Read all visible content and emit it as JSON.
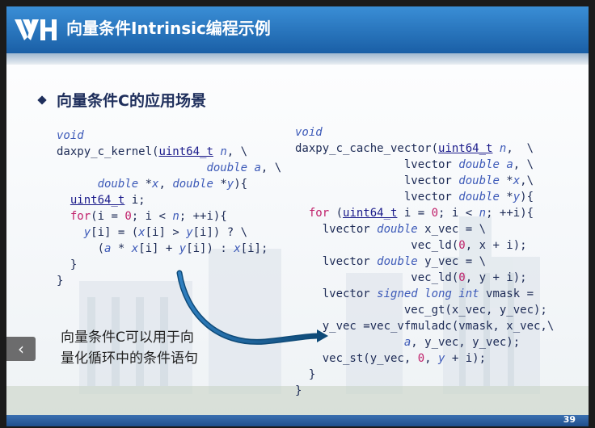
{
  "slide": {
    "title": "向量条件Intrinsic编程示例",
    "subtitle": "向量条件C的应用场景",
    "page_number": "39",
    "logo_text": "VH"
  },
  "note": {
    "line1": "向量条件C可以用于向",
    "line2": "量化循环中的条件语句"
  },
  "nav": {
    "prev_label": "‹"
  },
  "colors": {
    "title_bar": "#1a5fa6",
    "heading": "#1f2f5c",
    "keyword": "#c0206a",
    "type": "#3d5ab8",
    "arrow": "#0e4a78"
  }
}
